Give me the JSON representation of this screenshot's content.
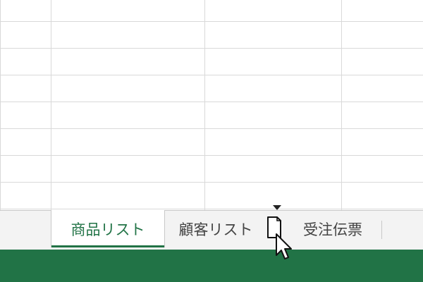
{
  "sheet_tabs": [
    {
      "label": "商品リスト",
      "active": true
    },
    {
      "label": "顧客リスト",
      "active": false
    },
    {
      "label": "受注伝票",
      "active": false
    }
  ],
  "colors": {
    "accent": "#217346",
    "grid_line": "#d9d9d9",
    "tab_bar_bg": "#f3f3f3"
  },
  "cursor": {
    "icon": "drag-sheet-cursor-icon"
  },
  "insert_marker": {
    "icon": "insert-position-marker-icon"
  }
}
